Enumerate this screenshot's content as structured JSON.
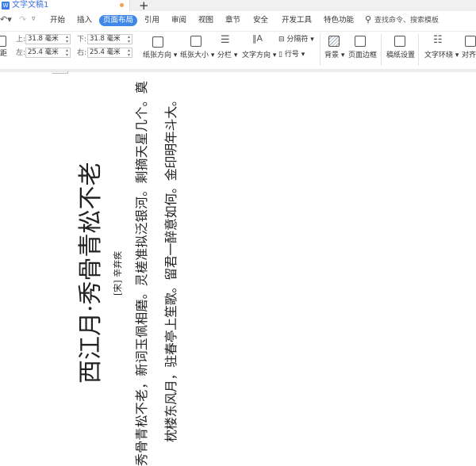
{
  "titlebar": {
    "doc_title": "文字文稿1",
    "app_icon": "W",
    "new_tab": "+"
  },
  "tabs": [
    {
      "label": "开始"
    },
    {
      "label": "插入"
    },
    {
      "label": "页面布局",
      "active": true
    },
    {
      "label": "引用"
    },
    {
      "label": "审阅"
    },
    {
      "label": "视图"
    },
    {
      "label": "章节"
    },
    {
      "label": "安全"
    },
    {
      "label": "开发工具"
    },
    {
      "label": "特色功能"
    }
  ],
  "search": {
    "placeholder": "查找命令、搜索模板"
  },
  "toolbar": {
    "margins_label": "距",
    "top_label": "上:",
    "top_value": "31.8 毫米",
    "bottom_label": "下:",
    "bottom_value": "31.8 毫米",
    "left_label": "左:",
    "left_value": "25.4 毫米",
    "right_label": "右:",
    "right_value": "25.4 毫米",
    "orientation": "纸张方向",
    "size": "纸张大小",
    "columns": "分栏",
    "text_direction": "文字方向",
    "breaks": "分隔符",
    "line_numbers": "行号",
    "background": "背景",
    "page_border": "页面边框",
    "manuscript": "稿纸设置",
    "wrap": "文字环绕",
    "align": "对齐"
  },
  "accent_color": "#3f88e8",
  "document": {
    "title": "西江月·秀骨青松不老",
    "author": "[宋] 辛弃疾",
    "lines": [
      "秀骨青松不老，新词玉佩相磨。灵槎准拟泛银河。剩摘天星几个。奠",
      "枕楼东风月，驻春亭上笙歌。留君一醉意如何。金印明年斗大。"
    ]
  }
}
